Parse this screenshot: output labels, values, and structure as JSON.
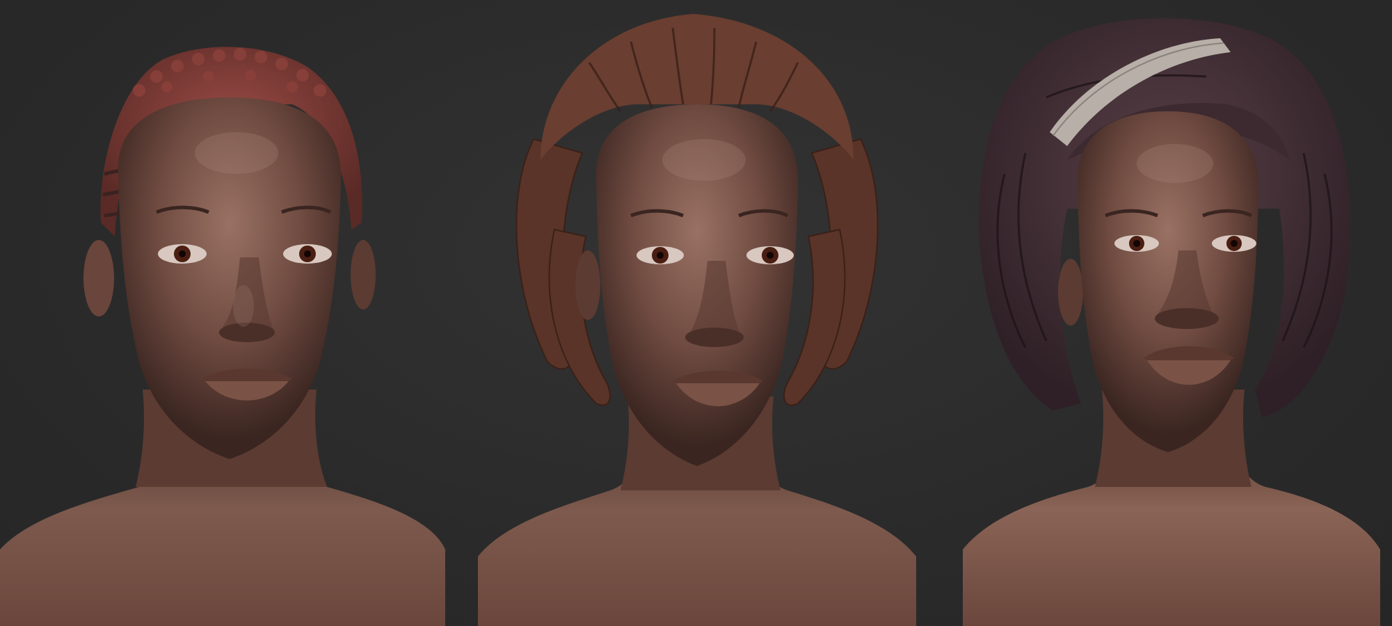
{
  "scene": {
    "background_color": "#2b2b2b",
    "skin_color": "#6e4a40",
    "skin_highlight": "#a07a6c",
    "skin_shadow": "#3a2520",
    "iris_color": "#4a1e12"
  },
  "busts": [
    {
      "name": "short-textured-hair",
      "hair_color": "#7a3a36",
      "hair_style": "short coily with side parts"
    },
    {
      "name": "locs-hair",
      "hair_color": "#5a3428",
      "hair_style": "short twisted locs"
    },
    {
      "name": "wrapped-hair-with-headband",
      "hair_color": "#3d2a30",
      "hair_style": "voluminous wrapped curls",
      "headband_color": "#b8b0a8"
    }
  ]
}
